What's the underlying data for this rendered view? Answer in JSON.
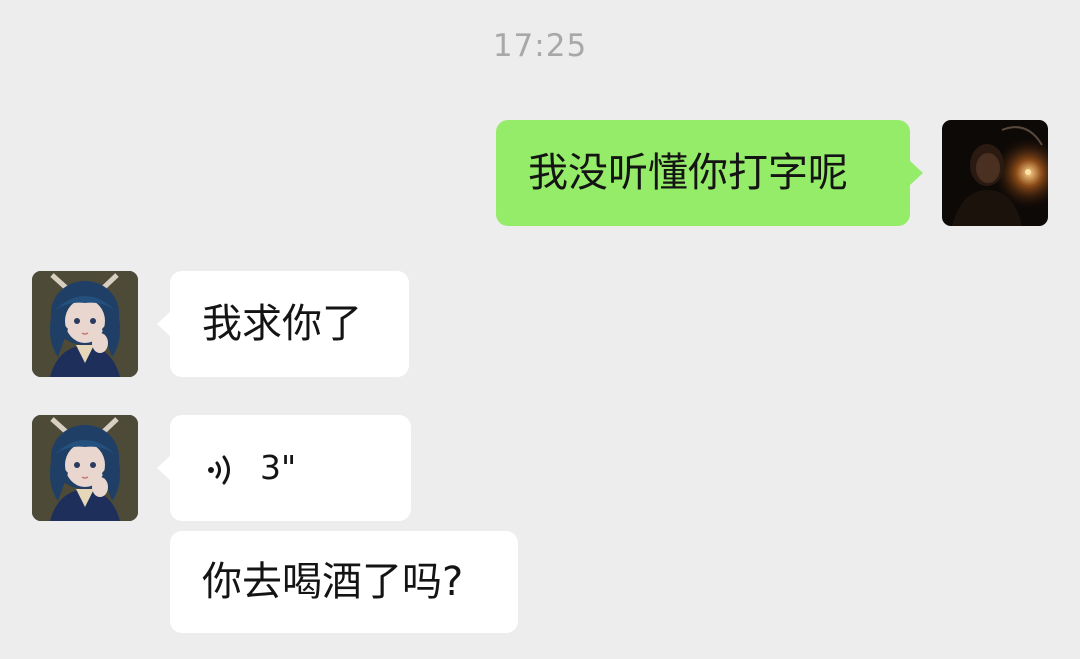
{
  "chat": {
    "timestamp": "17:25",
    "messages": [
      {
        "side": "right",
        "type": "text",
        "text": "我没听懂你打字呢",
        "avatar": "self-avatar-dark-photo"
      },
      {
        "side": "left",
        "type": "text",
        "text": "我求你了",
        "avatar": "anime-girl-avatar"
      },
      {
        "side": "left",
        "type": "voice",
        "duration": "3\"",
        "icon": "voice-wave-icon",
        "avatar": "anime-girl-avatar"
      },
      {
        "side": "left",
        "type": "text",
        "text": "你去喝酒了吗?"
      }
    ]
  },
  "colors": {
    "background": "#ededed",
    "sent_bubble": "#95ec69",
    "received_bubble": "#ffffff",
    "timestamp_text": "#a8a8a8",
    "message_text": "#141414"
  }
}
